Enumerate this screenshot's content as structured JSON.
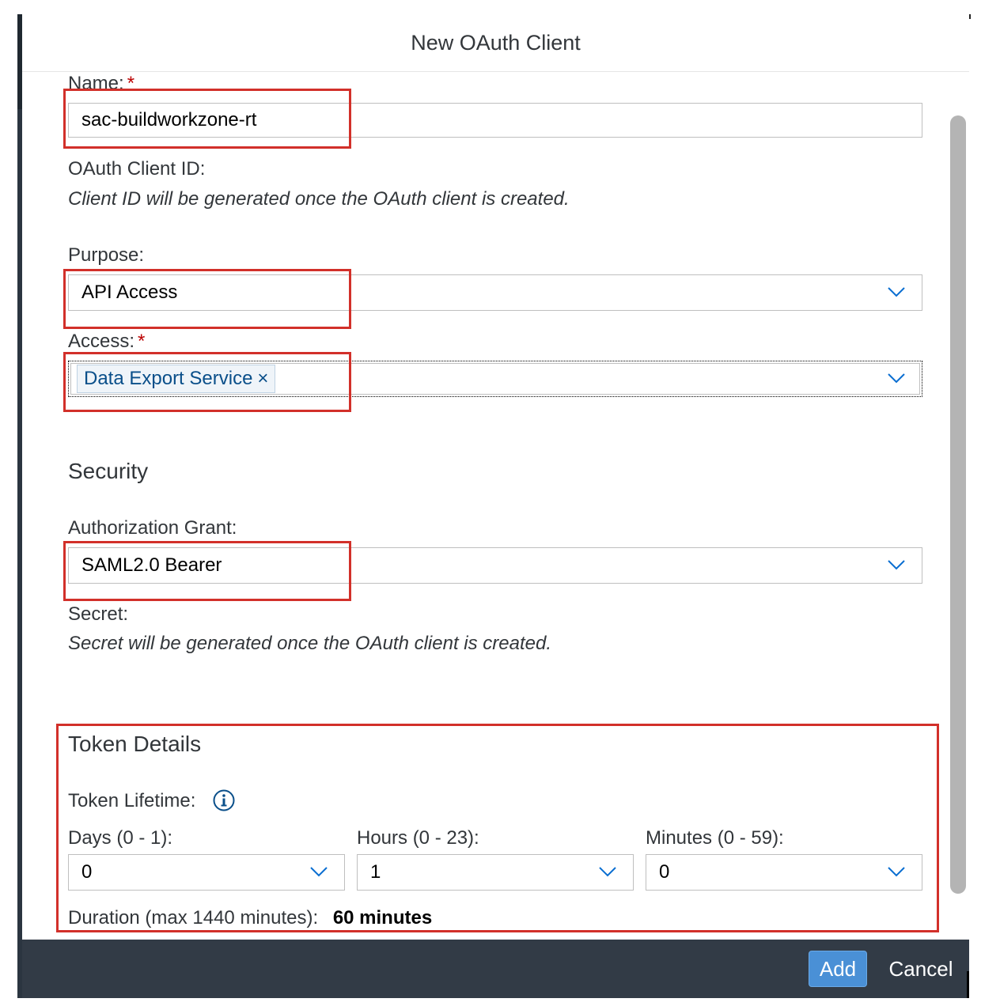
{
  "dialog": {
    "title": "New OAuth Client"
  },
  "form": {
    "name": {
      "label": "Name:",
      "required": "*",
      "value": "sac-buildworkzone-rt"
    },
    "client_id": {
      "label": "OAuth Client ID:",
      "note": "Client ID will be generated once the OAuth client is created."
    },
    "purpose": {
      "label": "Purpose:",
      "value": "API Access"
    },
    "access": {
      "label": "Access:",
      "required": "*",
      "token": "Data Export Service",
      "token_remove": "×"
    }
  },
  "security": {
    "heading": "Security",
    "grant": {
      "label": "Authorization Grant:",
      "value": "SAML2.0 Bearer"
    },
    "secret": {
      "label": "Secret:",
      "note": "Secret will be generated once the OAuth client is created."
    }
  },
  "token_details": {
    "heading": "Token Details",
    "lifetime_label": "Token Lifetime:",
    "days": {
      "label": "Days (0 - 1):",
      "value": "0"
    },
    "hours": {
      "label": "Hours (0 - 23):",
      "value": "1"
    },
    "minutes": {
      "label": "Minutes (0 - 59):",
      "value": "0"
    },
    "duration_label": "Duration (max 1440 minutes):",
    "duration_value": "60 minutes"
  },
  "footer": {
    "add_label": "Add",
    "cancel_label": "Cancel"
  },
  "colors": {
    "highlight": "#d2302a",
    "footer_bg": "#323b46",
    "primary_button": "#4a90d6",
    "required": "#bb0000",
    "token_text": "#0a4f8a"
  }
}
